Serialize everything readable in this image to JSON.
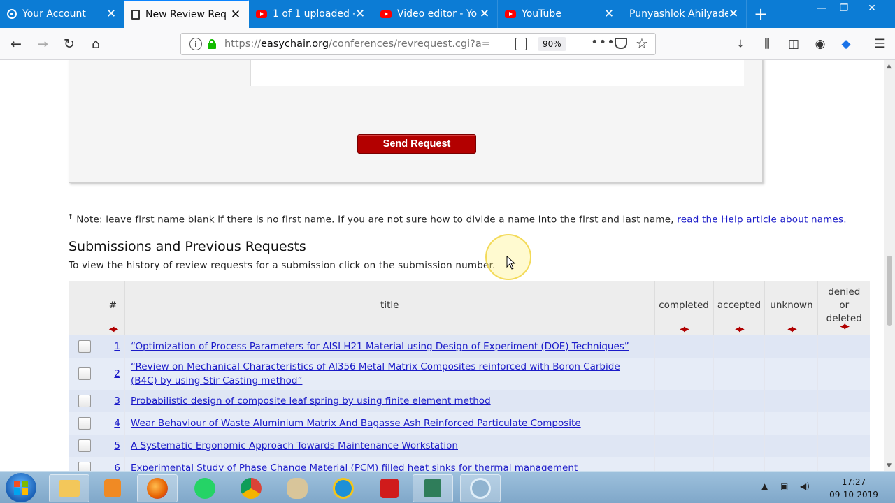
{
  "browser": {
    "tabs": [
      {
        "label": "Your Account",
        "icon": "account-icon",
        "active": false
      },
      {
        "label": "New Review Req",
        "icon": "document-icon",
        "active": true
      },
      {
        "label": "1 of 1 uploaded -",
        "icon": "youtube-icon",
        "active": false
      },
      {
        "label": "Video editor - Yo",
        "icon": "youtube-icon",
        "active": false
      },
      {
        "label": "YouTube",
        "icon": "youtube-icon",
        "active": false
      },
      {
        "label": "Punyashlok Ahilyade",
        "icon": "",
        "active": false
      }
    ],
    "url_prefix": "https://",
    "url_host": "easychair.org",
    "url_path": "/conferences/revrequest.cgi?a=",
    "zoom": "90%"
  },
  "form": {
    "send_button": "Send Request"
  },
  "note": {
    "marker": "†",
    "text": "Note: leave first name blank if there is no first name. If you are not sure how to divide a name into the first and last name,",
    "link": "read the Help article about names."
  },
  "section": {
    "heading": "Submissions and Previous Requests",
    "subtext": "To view the history of review requests for a submission click on the submission number."
  },
  "table": {
    "headers": {
      "num": "#",
      "title": "title",
      "completed": "completed",
      "accepted": "accepted",
      "unknown": "unknown",
      "denied": "denied or deleted"
    },
    "rows": [
      {
        "num": "1",
        "title": "“Optimization of Process Parameters for AISI H21 Material using Design of Experiment (DOE) Techniques”"
      },
      {
        "num": "2",
        "title": "“Review on Mechanical Characteristics of Al356 Metal Matrix Composites reinforced with Boron Carbide (B4C) by using Stir Casting method”"
      },
      {
        "num": "3",
        "title": "Probabilistic design of composite leaf spring by using finite element method"
      },
      {
        "num": "4",
        "title": "Wear Behaviour of Waste Aluminium Matrix And Bagasse Ash Reinforced Particulate Composite"
      },
      {
        "num": "5",
        "title": "A Systematic Ergonomic Approach Towards Maintenance Workstation"
      },
      {
        "num": "6",
        "title": "Experimental Study of Phase Change Material (PCM) filled heat sinks for thermal management"
      }
    ]
  },
  "taskbar": {
    "time": "17:27",
    "date": "09-10-2019"
  },
  "colors": {
    "tabstrip": "#0c7cd5",
    "send_button": "#b30000",
    "link": "#1a1ac8",
    "row_bg": "#e6ecf7"
  }
}
